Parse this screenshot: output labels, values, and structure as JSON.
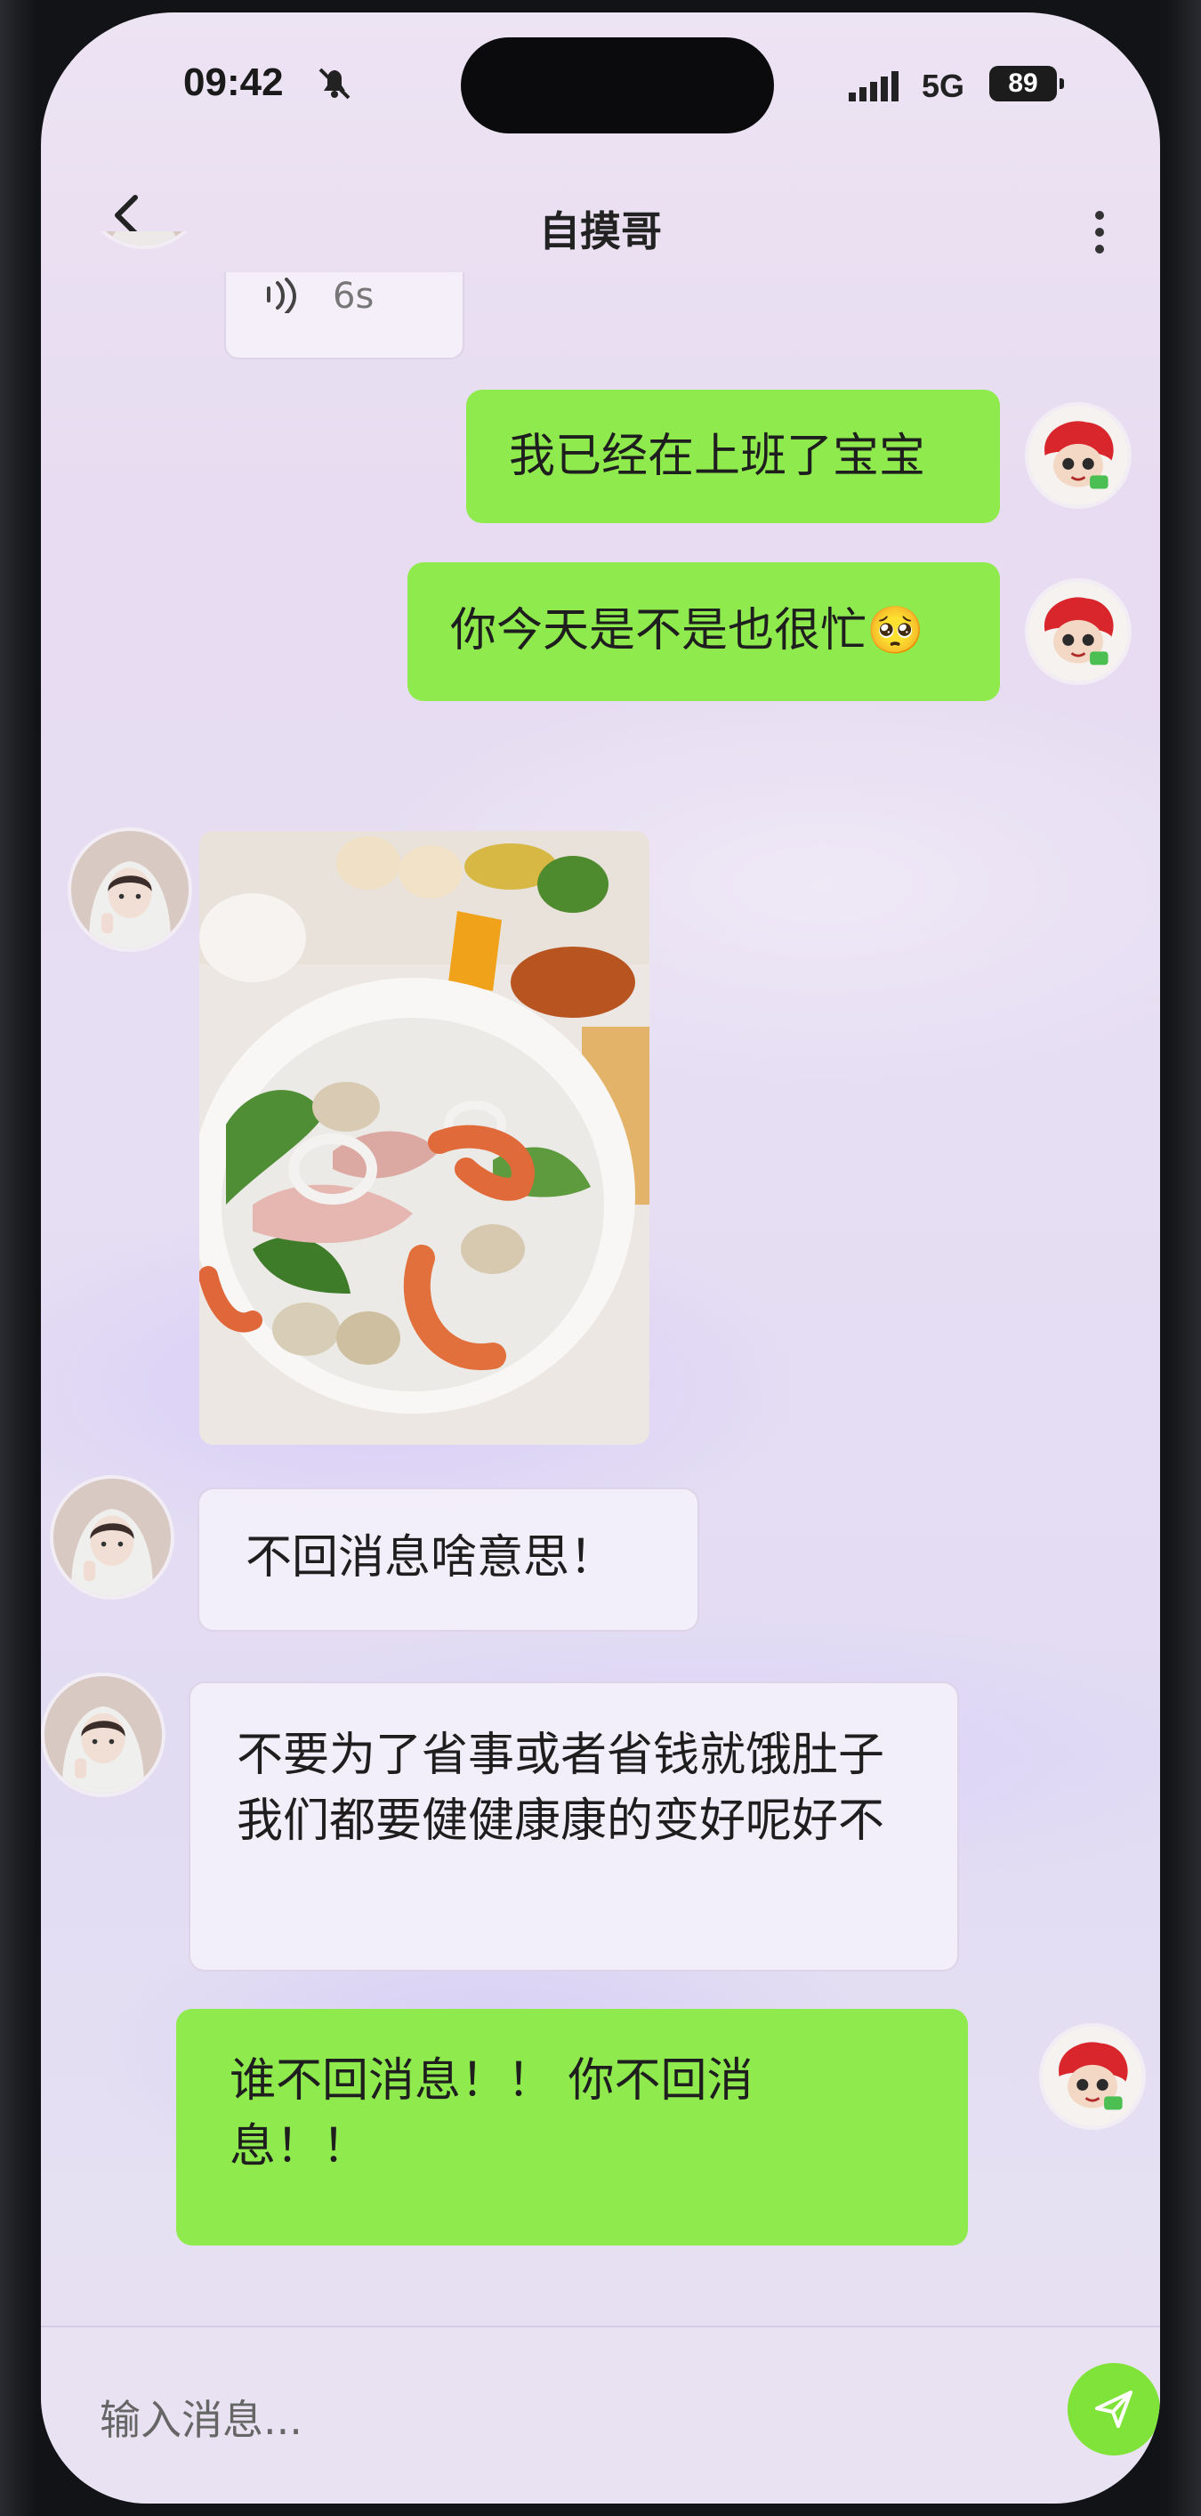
{
  "status_bar": {
    "time": "09:42",
    "network": "5G",
    "battery": "89"
  },
  "header": {
    "title": "自摸哥"
  },
  "messages": [
    {
      "sender": "them",
      "type": "voice",
      "duration": "6s"
    },
    {
      "sender": "me",
      "type": "text",
      "text": "我已经在上班了宝宝"
    },
    {
      "sender": "me",
      "type": "text",
      "text": "你今天是不是也很忙🥺"
    },
    {
      "sender": "them",
      "type": "image",
      "description": ""
    },
    {
      "sender": "them",
      "type": "text",
      "text": "不回消息啥意思！"
    },
    {
      "sender": "them",
      "type": "text",
      "text": "不要为了省事或者省钱就饿肚子 我们都要健健康康的变好呢好不"
    },
    {
      "sender": "me",
      "type": "text",
      "text": "谁不回消息！！ 你不回消息！！"
    }
  ],
  "input": {
    "placeholder": "输入消息..."
  },
  "colors": {
    "my_bubble": "#8fea4d",
    "their_bubble": "#f6f2fa",
    "send_button": "#7fe33a"
  },
  "icons": {
    "back": "chevron-left-icon",
    "more": "vertical-dots-icon",
    "send": "paper-plane-icon",
    "mute": "bell-slash-icon",
    "signal": "signal-bars-icon",
    "voice": "sound-wave-icon"
  }
}
